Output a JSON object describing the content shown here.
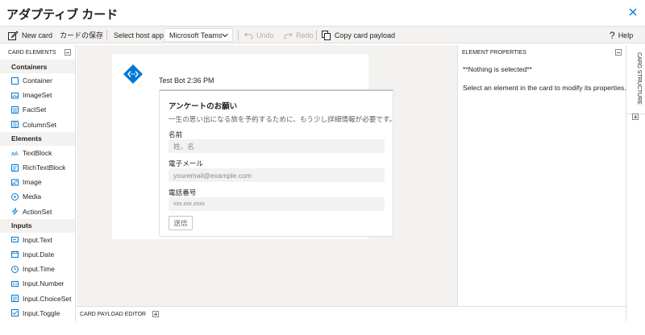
{
  "window": {
    "title": "アダプティブ カード"
  },
  "toolbar": {
    "new_card": "New card",
    "save_card": "カードの保存",
    "host_app_label": "Select host app:",
    "host_app_value": "Microsoft Teams",
    "undo": "Undo",
    "redo": "Redo",
    "copy_payload": "Copy card payload",
    "help_glyph": "?",
    "help": "Help"
  },
  "sidebar": {
    "header": "CARD ELEMENTS",
    "groups": [
      {
        "label": "Containers",
        "items": [
          {
            "label": "Container",
            "icon": "container-icon"
          },
          {
            "label": "ImageSet",
            "icon": "imageset-icon"
          },
          {
            "label": "FactSet",
            "icon": "factset-icon"
          },
          {
            "label": "ColumnSet",
            "icon": "columnset-icon"
          }
        ]
      },
      {
        "label": "Elements",
        "items": [
          {
            "label": "TextBlock",
            "icon": "textblock-icon"
          },
          {
            "label": "RichTextBlock",
            "icon": "richtextblock-icon"
          },
          {
            "label": "Image",
            "icon": "image-icon"
          },
          {
            "label": "Media",
            "icon": "media-icon"
          },
          {
            "label": "ActionSet",
            "icon": "actionset-icon"
          }
        ]
      },
      {
        "label": "Inputs",
        "items": [
          {
            "label": "Input.Text",
            "icon": "input-text-icon"
          },
          {
            "label": "Input.Date",
            "icon": "input-date-icon"
          },
          {
            "label": "Input.Time",
            "icon": "input-time-icon"
          },
          {
            "label": "Input.Number",
            "icon": "input-number-icon"
          },
          {
            "label": "Input.ChoiceSet",
            "icon": "input-choiceset-icon"
          },
          {
            "label": "Input.Toggle",
            "icon": "input-toggle-icon"
          }
        ]
      }
    ]
  },
  "preview": {
    "bot_name": "Test Bot 2:36 PM",
    "card": {
      "title": "アンケートのお願い",
      "description": "一生の思い出になる旅を予約するために、もう少し詳細情報が必要です。",
      "fields": [
        {
          "label": "名前",
          "placeholder": "姓、名"
        },
        {
          "label": "電子メール",
          "placeholder": "youremail@example.com"
        },
        {
          "label": "電話番号",
          "placeholder": "xxx.xxx.xxxx"
        }
      ],
      "submit": "送信"
    }
  },
  "payload_editor": {
    "label": "CARD PAYLOAD EDITOR"
  },
  "properties": {
    "header": "ELEMENT PROPERTIES",
    "nothing_selected": "**Nothing is selected**",
    "hint": "Select an element in the card to modify its properties."
  },
  "structure_tab": {
    "label": "CARD STRUCTURE"
  },
  "colors": {
    "accent": "#0078d4",
    "canvas_bg": "#f3f2f1",
    "disabled": "#b3b0ad"
  }
}
